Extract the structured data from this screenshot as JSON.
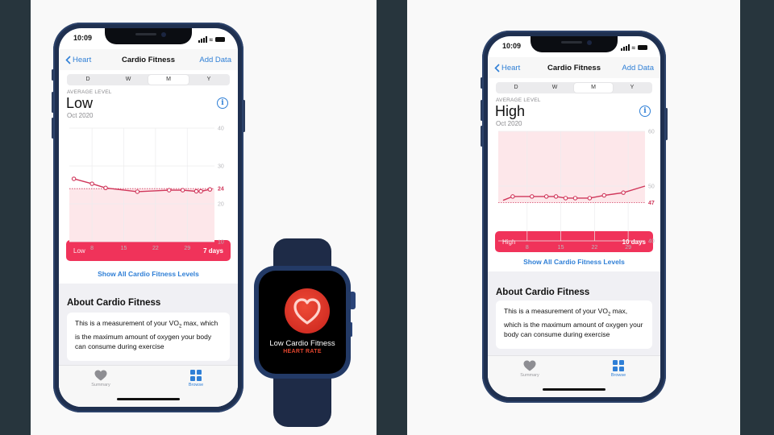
{
  "colors": {
    "accent": "#2f7fd6",
    "level_bar": "#f0335a",
    "chart_line": "#d0365a",
    "chart_fill": "#fde7ea",
    "backdrop": "#27353d"
  },
  "phones": [
    {
      "status_time": "10:09",
      "nav": {
        "back_label": "Heart",
        "title": "Cardio Fitness",
        "action_label": "Add Data"
      },
      "segments": [
        "D",
        "W",
        "M",
        "Y"
      ],
      "selected_segment": "M",
      "average_label": "AVERAGE LEVEL",
      "level": "Low",
      "period": "Oct 2020",
      "info_icon": "info-circle-icon",
      "level_bar": {
        "label": "Low",
        "value": "7 days"
      },
      "show_all_label": "Show All Cardio Fitness Levels",
      "about_title": "About Cardio Fitness",
      "about_text_1": "This is a measurement of your VO",
      "about_sub": "2",
      "about_text_2": " max, which is the maximum amount of oxygen your body can consume during exercise",
      "tabs": [
        {
          "label": "Summary",
          "icon": "heart-icon",
          "active": false
        },
        {
          "label": "Browse",
          "icon": "grid-icon",
          "active": true
        }
      ]
    },
    {
      "status_time": "10:09",
      "nav": {
        "back_label": "Heart",
        "title": "Cardio Fitness",
        "action_label": "Add Data"
      },
      "segments": [
        "D",
        "W",
        "M",
        "Y"
      ],
      "selected_segment": "M",
      "average_label": "AVERAGE LEVEL",
      "level": "High",
      "period": "Oct 2020",
      "info_icon": "info-circle-icon",
      "level_bar": {
        "label": "High",
        "value": "10 days"
      },
      "show_all_label": "Show All Cardio Fitness Levels",
      "about_title": "About Cardio Fitness",
      "about_text_1": "This is a measurement of your VO",
      "about_sub": "2",
      "about_text_2": " max, which is the maximum amount of oxygen your body can consume during exercise",
      "tabs": [
        {
          "label": "Summary",
          "icon": "heart-icon",
          "active": false
        },
        {
          "label": "Browse",
          "icon": "grid-icon",
          "active": true
        }
      ]
    }
  ],
  "watch": {
    "title": "Low Cardio Fitness",
    "subtitle": "HEART RATE",
    "icon": "heart-icon"
  },
  "chart_data": [
    {
      "type": "line",
      "title": "Cardio Fitness (Low)",
      "x": [
        4,
        8,
        11,
        18,
        25,
        28,
        31,
        32,
        34
      ],
      "values": [
        26.6,
        25.3,
        24.2,
        23.2,
        23.6,
        23.6,
        23.3,
        23.3,
        23.8
      ],
      "x_ticks": [
        "8",
        "15",
        "22",
        "29"
      ],
      "x_tick_values": [
        8,
        15,
        22,
        29
      ],
      "y_ticks": [
        "40",
        "30",
        "20",
        "10"
      ],
      "y_tick_values": [
        40,
        30,
        20,
        10
      ],
      "ylim": [
        10,
        40
      ],
      "xlim": [
        3,
        35
      ],
      "threshold": 24,
      "threshold_label": "24",
      "band": [
        10,
        24
      ],
      "line_extends_to_edges": false
    },
    {
      "type": "line",
      "title": "Cardio Fitness (High)",
      "x": [
        3,
        5,
        9,
        12,
        14,
        16,
        18,
        21,
        24,
        28,
        32.5
      ],
      "values": [
        47.4,
        48.1,
        48.1,
        48.1,
        48.1,
        47.8,
        47.8,
        47.8,
        48.3,
        48.8,
        50
      ],
      "markers": [
        false,
        true,
        true,
        true,
        true,
        true,
        true,
        true,
        true,
        true,
        false
      ],
      "x_ticks": [
        "8",
        "15",
        "22",
        "29"
      ],
      "x_tick_values": [
        8,
        15,
        22,
        29
      ],
      "y_ticks": [
        "60",
        "50",
        "40"
      ],
      "y_tick_values": [
        60,
        50,
        40
      ],
      "ylim": [
        40,
        60
      ],
      "xlim": [
        2,
        32.5
      ],
      "threshold": 47,
      "threshold_label": "47",
      "band": [
        47,
        60
      ]
    }
  ]
}
